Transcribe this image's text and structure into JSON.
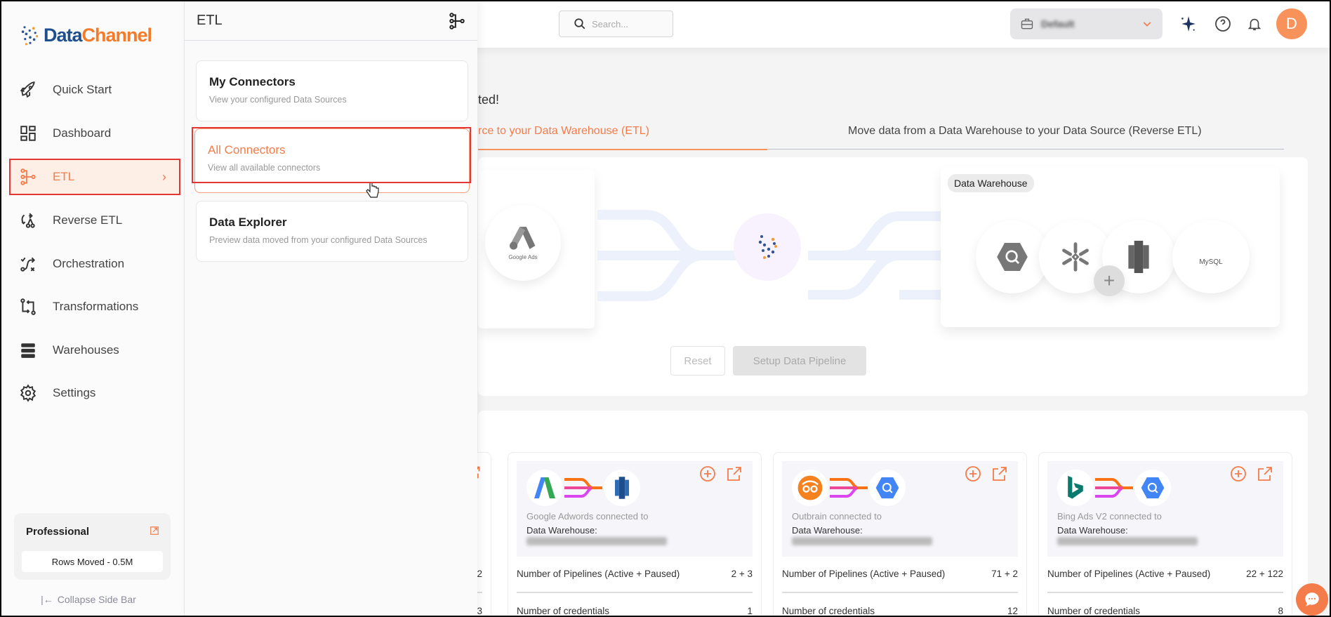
{
  "header": {
    "search_placeholder": "Search...",
    "workspace": "Default"
  },
  "sidebar": {
    "logo": {
      "part1": "Data",
      "part2": "Channel"
    },
    "items": [
      {
        "label": "Quick Start",
        "icon": "rocket-icon"
      },
      {
        "label": "Dashboard",
        "icon": "grid-icon"
      },
      {
        "label": "ETL",
        "icon": "etl-icon",
        "active": true
      },
      {
        "label": "Reverse ETL",
        "icon": "reverse-etl-icon"
      },
      {
        "label": "Orchestration",
        "icon": "orchestration-icon"
      },
      {
        "label": "Transformations",
        "icon": "transform-icon"
      },
      {
        "label": "Warehouses",
        "icon": "database-icon"
      },
      {
        "label": "Settings",
        "icon": "gear-icon"
      }
    ],
    "plan": {
      "name": "Professional",
      "rows_moved": "Rows Moved - 0.5M"
    },
    "collapse": "Collapse Side Bar"
  },
  "panel": {
    "title": "ETL",
    "items": [
      {
        "title": "My Connectors",
        "subtitle": "View your configured Data Sources"
      },
      {
        "title": "All Connectors",
        "subtitle": "View all available connectors"
      },
      {
        "title": "Data Explorer",
        "subtitle": "Preview data moved from your configured Data Sources"
      }
    ]
  },
  "main": {
    "welcome_fragment": "ted!",
    "tabs": [
      {
        "label": "rce to your Data Warehouse (ETL)",
        "active": true
      },
      {
        "label": "Move data from a Data Warehouse to your Data Source (Reverse ETL)"
      }
    ],
    "diagram": {
      "source_logo": "Google Ads",
      "warehouse_label": "Data Warehouse",
      "warehouse_logos": [
        "BigQuery",
        "Snowflake",
        "Redshift",
        "MySQL"
      ],
      "reset": "Reset",
      "setup": "Setup Data Pipeline"
    },
    "cards": [
      {
        "partial": true,
        "pipelines_value": "2",
        "credentials_value": "3"
      },
      {
        "source": "Google Adwords connected to",
        "warehouse_label": "Data Warehouse:",
        "pipelines_label": "Number of Pipelines (Active + Paused)",
        "pipelines_value": "2 + 3",
        "credentials_label": "Number of credentials",
        "credentials_value": "1"
      },
      {
        "source": "Outbrain connected to",
        "warehouse_label": "Data Warehouse:",
        "pipelines_label": "Number of Pipelines (Active + Paused)",
        "pipelines_value": "71 + 2",
        "credentials_label": "Number of credentials",
        "credentials_value": "12"
      },
      {
        "source": "Bing Ads V2 connected to",
        "warehouse_label": "Data Warehouse:",
        "pipelines_label": "Number of Pipelines (Active + Paused)",
        "pipelines_value": "22 + 122",
        "credentials_label": "Number of credentials",
        "credentials_value": "8"
      }
    ]
  },
  "colors": {
    "accent": "#f47b4a",
    "brand_blue": "#1f4e8c",
    "highlight": "#e53535"
  }
}
